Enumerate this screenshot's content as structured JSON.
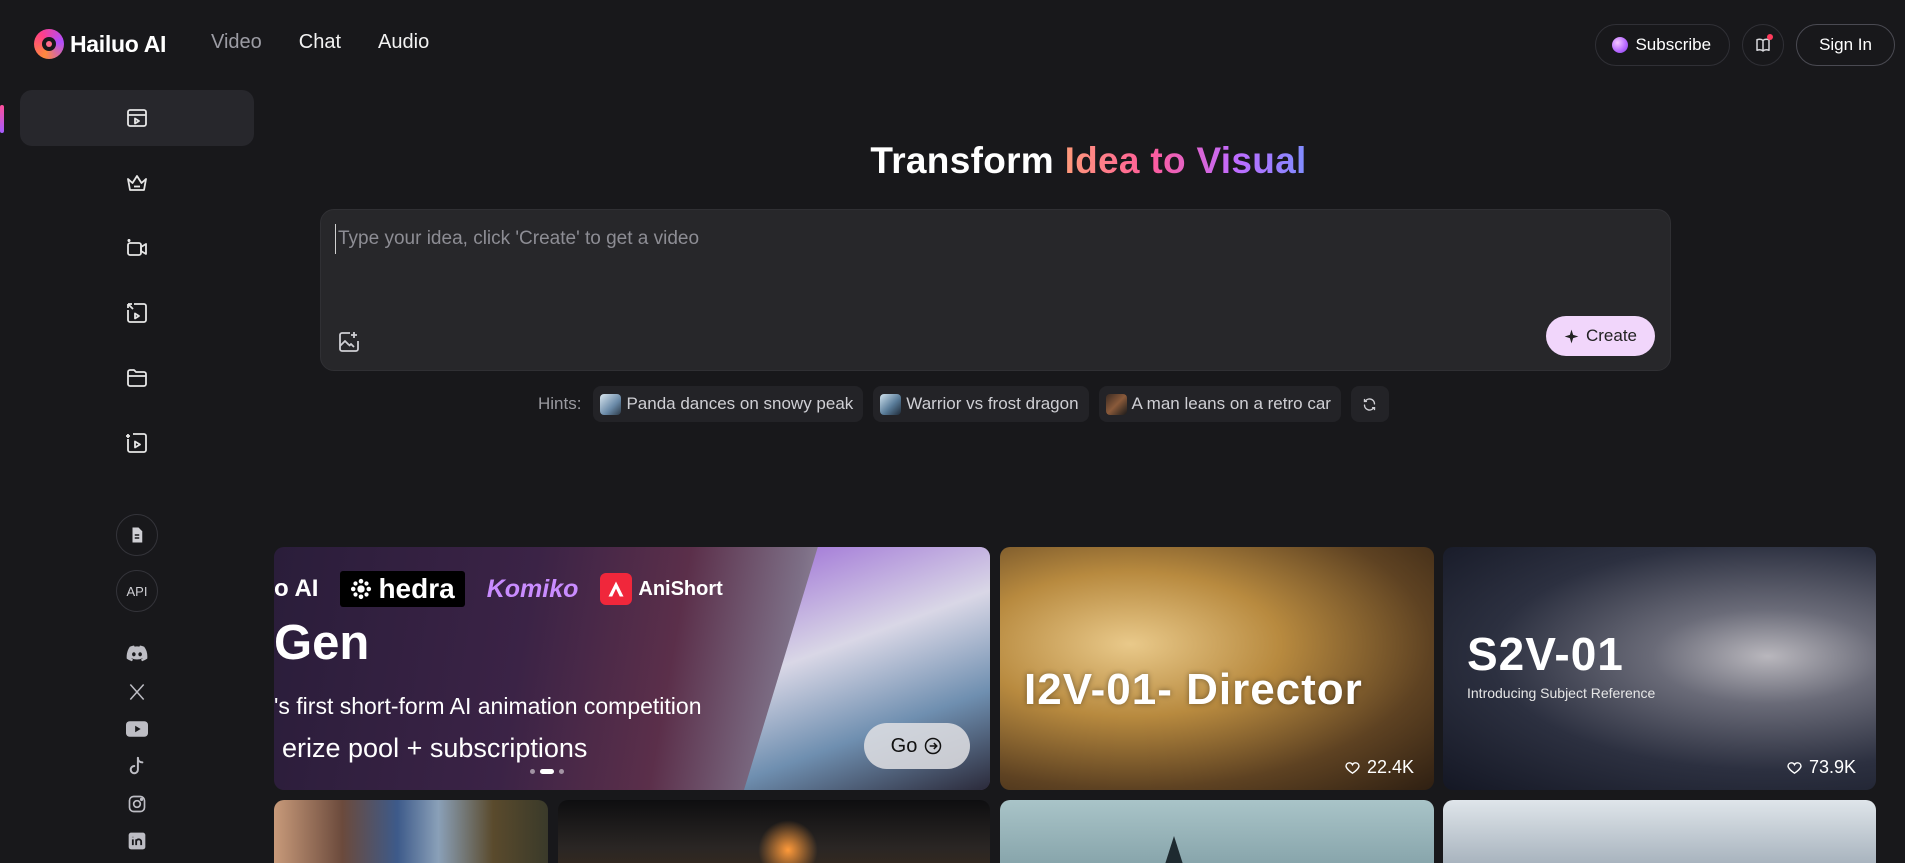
{
  "brand": {
    "name": "Hailuo AI"
  },
  "nav": {
    "items": [
      {
        "label": "Video",
        "active": true
      },
      {
        "label": "Chat",
        "active": false
      },
      {
        "label": "Audio",
        "active": false
      }
    ]
  },
  "header": {
    "subscribe_label": "Subscribe",
    "signin_label": "Sign In"
  },
  "sidebar": {
    "items": [
      "video-create-icon",
      "crown-icon",
      "camera-video-icon",
      "image-to-video-icon",
      "folder-icon",
      "play-upload-icon"
    ],
    "api_label": "API",
    "socials": [
      "discord-icon",
      "x-icon",
      "youtube-icon",
      "tiktok-icon",
      "instagram-icon",
      "linkedin-icon"
    ]
  },
  "hero": {
    "title_plain": "Transform ",
    "title_grad": "Idea to Visual",
    "prompt_placeholder": "Type your idea, click 'Create' to get a video",
    "create_label": "Create"
  },
  "hints": {
    "label": "Hints:",
    "items": [
      "Panda dances on snowy peak",
      "Warrior vs frost dragon",
      "A man leans on a retro car"
    ]
  },
  "gallery": {
    "banner": {
      "partner_1": "o AI",
      "partner_hedra": "hedra",
      "partner_komiko": "Komiko",
      "partner_anishort": "AniShort",
      "title": "Gen",
      "subtitle": "'s first short-form AI animation competition",
      "prize": "erize pool + subscriptions",
      "go_label": "Go"
    },
    "videos": [
      {
        "title": "I2V-01-    Director",
        "likes": "22.4K"
      },
      {
        "title": "S2V-01",
        "subtitle": "Introducing Subject Reference",
        "likes": "73.9K"
      }
    ]
  },
  "colors": {
    "background": "#18181b",
    "accent_gradient_start": "#ff9a7a",
    "accent_gradient_end": "#7f8dff",
    "create_button": "#f1d6fb"
  }
}
